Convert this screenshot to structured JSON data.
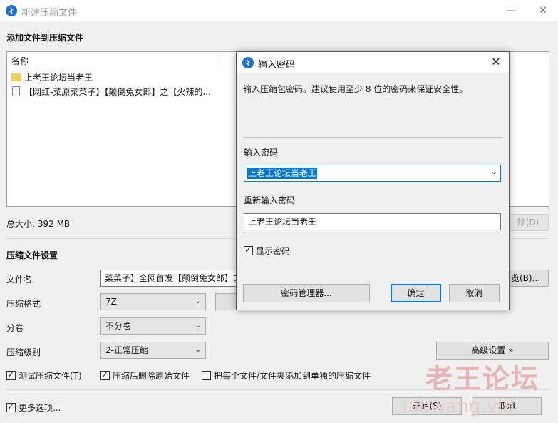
{
  "window": {
    "title": "新建压缩文件",
    "min_icon": "minimize-icon",
    "close_icon": "close-icon"
  },
  "add_files": {
    "heading": "添加文件到压缩文件",
    "column_name": "名称",
    "items": [
      {
        "icon": "folder-icon",
        "name": "上老王论坛当老王"
      },
      {
        "icon": "document-icon",
        "name": "【网红-菜原菜菜子】【颠倒兔女郎】之【火辣的..."
      }
    ],
    "total_size": "总大小: 392 MB",
    "remove_button": "除(D)"
  },
  "settings": {
    "heading": "压缩文件设置",
    "filename_label": "文件名",
    "filename_value": "菜菜子】全网首发【颠倒兔女郎】之",
    "browse_button": "览(B)...",
    "format_label": "压缩格式",
    "format_value": "7Z",
    "split_label": "分卷",
    "split_value": "不分卷",
    "level_label": "压缩级别",
    "level_value": "2-正常压缩",
    "advanced_button": "高级设置 »",
    "test_check": "测试压缩文件(T)",
    "delete_check": "压缩后删除原始文件",
    "each_check": "把每个文件/文件夹添加到单独的压缩文件",
    "more_options": "更多选项...",
    "start_button": "开始(S)",
    "cancel_button": "取消"
  },
  "password_dialog": {
    "title": "输入密码",
    "instruction": "输入压缩包密码。建议使用至少 8 位的密码来保证安全性。",
    "password_label": "输入密码",
    "password_value": "上老王论坛当老王",
    "reenter_label": "重新输入密码",
    "reenter_value": "上老王论坛当老王",
    "show_password": "显示密码",
    "manager_button": "密码管理器...",
    "ok_button": "确定",
    "cancel_button": "取消"
  },
  "watermark": {
    "text": "老王论坛",
    "url": "laowang.vip"
  },
  "colors": {
    "accent": "#0078d7",
    "window_bg": "#f0f0f0",
    "folder": "#f3cd5d"
  }
}
